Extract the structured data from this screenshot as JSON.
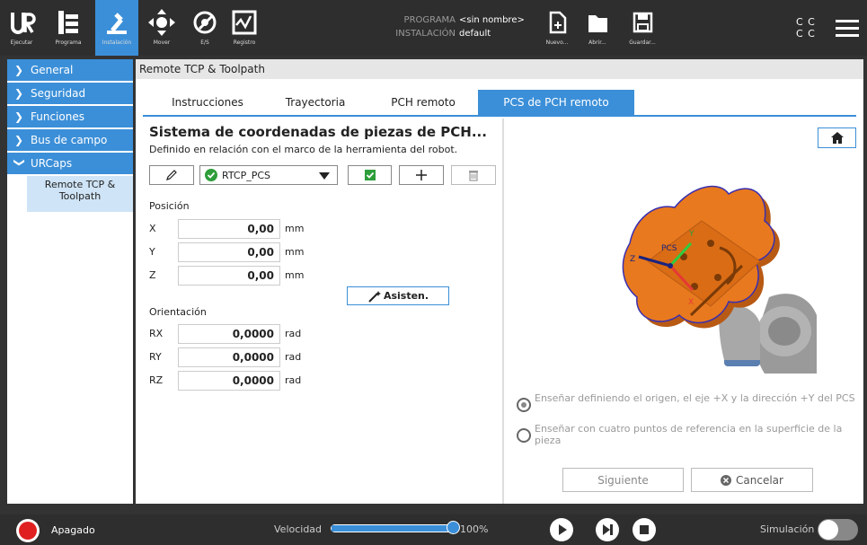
{
  "topbar": {
    "buttons": [
      {
        "label": "Ejecutar"
      },
      {
        "label": "Programa"
      },
      {
        "label": "Instalación"
      },
      {
        "label": "Mover"
      },
      {
        "label": "E/S"
      },
      {
        "label": "Registro"
      }
    ],
    "programa_label": "PROGRAMA",
    "programa_value": "<sin nombre>",
    "instalacion_label": "INSTALACIÓN",
    "instalacion_value": "default",
    "file_buttons": [
      {
        "label": "Nuevo..."
      },
      {
        "label": "Abrir..."
      },
      {
        "label": "Guardar..."
      }
    ],
    "cc_top": "C C",
    "cc_bottom": "C C"
  },
  "sidebar": {
    "items": [
      {
        "label": "General"
      },
      {
        "label": "Seguridad"
      },
      {
        "label": "Funciones"
      },
      {
        "label": "Bus de campo"
      },
      {
        "label": "URCaps"
      }
    ],
    "sub_item": "Remote TCP & Toolpath"
  },
  "main": {
    "title": "Remote TCP & Toolpath",
    "tabs": [
      {
        "label": "Instrucciones"
      },
      {
        "label": "Trayectoria"
      },
      {
        "label": "PCH remoto"
      },
      {
        "label": "PCS de PCH remoto"
      }
    ],
    "heading": "Sistema de coordenadas de piezas de PCH...",
    "subheading": "Definido en relación con el marco de la herramienta del robot.",
    "pcs_select": "RTCP_PCS",
    "position_label": "Posición",
    "position": [
      {
        "axis": "X",
        "value": "0,00",
        "unit": "mm"
      },
      {
        "axis": "Y",
        "value": "0,00",
        "unit": "mm"
      },
      {
        "axis": "Z",
        "value": "0,00",
        "unit": "mm"
      }
    ],
    "wizard_button": "Asisten.",
    "orientation_label": "Orientación",
    "orientation": [
      {
        "axis": "RX",
        "value": "0,0000",
        "unit": "rad"
      },
      {
        "axis": "RY",
        "value": "0,0000",
        "unit": "rad"
      },
      {
        "axis": "RZ",
        "value": "0,0000",
        "unit": "rad"
      }
    ],
    "image_labels": {
      "pcs": "PCS",
      "x": "X",
      "y": "Y",
      "z": "Z"
    },
    "option1": "Enseñar definiendo el origen, el eje +X y la dirección +Y del PCS",
    "option2": "Enseñar con cuatro puntos de referencia en la superficie de la pieza",
    "next_button": "Siguiente",
    "cancel_button": "Cancelar"
  },
  "bottombar": {
    "power_status": "Apagado",
    "speed_label": "Velocidad",
    "speed_value": "100%",
    "speed_fraction": 1.0,
    "simulation_label": "Simulación"
  },
  "colors": {
    "accent": "#3b8fd8",
    "check_green": "#2e9e3a",
    "stop_red": "#e02020",
    "part_orange": "#e8791e"
  }
}
